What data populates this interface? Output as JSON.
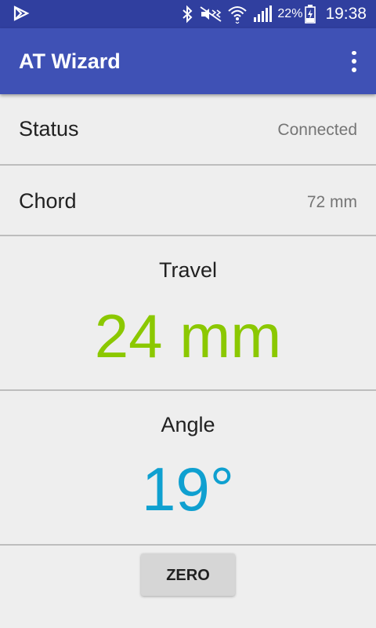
{
  "status_bar": {
    "battery_percent": "22%",
    "time": "19:38",
    "icons": [
      "app-notification-icon",
      "bluetooth-icon",
      "mute-vibrate-icon",
      "wifi-icon",
      "signal-icon",
      "battery-charging-icon"
    ]
  },
  "toolbar": {
    "title": "AT Wizard",
    "overflow_icon": "more-vert-icon"
  },
  "rows": {
    "status": {
      "label": "Status",
      "value": "Connected"
    },
    "chord": {
      "label": "Chord",
      "value": "72 mm"
    }
  },
  "travel": {
    "heading": "Travel",
    "value": "24 mm"
  },
  "angle": {
    "heading": "Angle",
    "value": "19°"
  },
  "actions": {
    "zero_label": "ZERO"
  },
  "colors": {
    "status_bar": "#303f9f",
    "toolbar": "#3f51b5",
    "travel_value": "#8bc800",
    "angle_value": "#0fa0d0",
    "background": "#eeeeee"
  }
}
